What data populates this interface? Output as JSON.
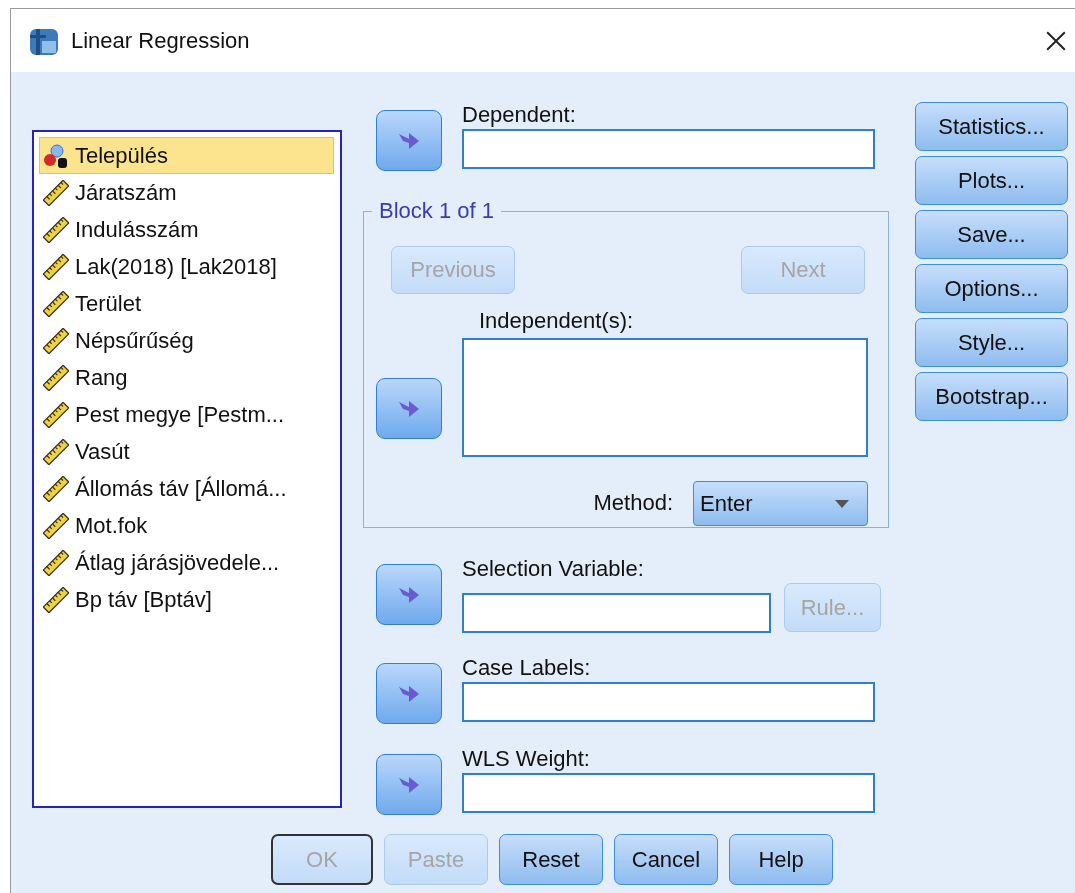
{
  "window": {
    "title": "Linear Regression"
  },
  "variables": [
    {
      "label": "Település",
      "kind": "nominal",
      "selected": true
    },
    {
      "label": "Járatszám",
      "kind": "scale",
      "selected": false
    },
    {
      "label": "Indulásszám",
      "kind": "scale",
      "selected": false
    },
    {
      "label": "Lak(2018) [Lak2018]",
      "kind": "scale",
      "selected": false
    },
    {
      "label": "Terület",
      "kind": "scale",
      "selected": false
    },
    {
      "label": "Népsűrűség",
      "kind": "scale",
      "selected": false
    },
    {
      "label": "Rang",
      "kind": "scale",
      "selected": false
    },
    {
      "label": "Pest megye [Pestm...",
      "kind": "scale",
      "selected": false
    },
    {
      "label": "Vasút",
      "kind": "scale",
      "selected": false
    },
    {
      "label": "Állomás táv [Állomá...",
      "kind": "scale",
      "selected": false
    },
    {
      "label": "Mot.fok",
      "kind": "scale",
      "selected": false
    },
    {
      "label": "Átlag járásjövedele...",
      "kind": "scale",
      "selected": false
    },
    {
      "label": "Bp táv [Bptáv]",
      "kind": "scale",
      "selected": false
    }
  ],
  "dependent": {
    "label": "Dependent:"
  },
  "block": {
    "legend": "Block 1 of 1",
    "previous": {
      "label": "Previous",
      "disabled": true
    },
    "next": {
      "label": "Next",
      "disabled": true
    },
    "independents_label": "Independent(s):",
    "method_label": "Method:",
    "method": "Enter"
  },
  "selection": {
    "label": "Selection Variable:",
    "rule": {
      "label": "Rule...",
      "disabled": true
    }
  },
  "case_labels": {
    "label": "Case Labels:"
  },
  "wls_weight": {
    "label": "WLS Weight:"
  },
  "side_buttons": [
    "Statistics...",
    "Plots...",
    "Save...",
    "Options...",
    "Style...",
    "Bootstrap..."
  ],
  "bottom_buttons": [
    {
      "label": "OK",
      "disabled": true,
      "default": true
    },
    {
      "label": "Paste",
      "disabled": true,
      "default": false
    },
    {
      "label": "Reset",
      "disabled": false,
      "default": false
    },
    {
      "label": "Cancel",
      "disabled": false,
      "default": false
    },
    {
      "label": "Help",
      "disabled": false,
      "default": false
    }
  ]
}
